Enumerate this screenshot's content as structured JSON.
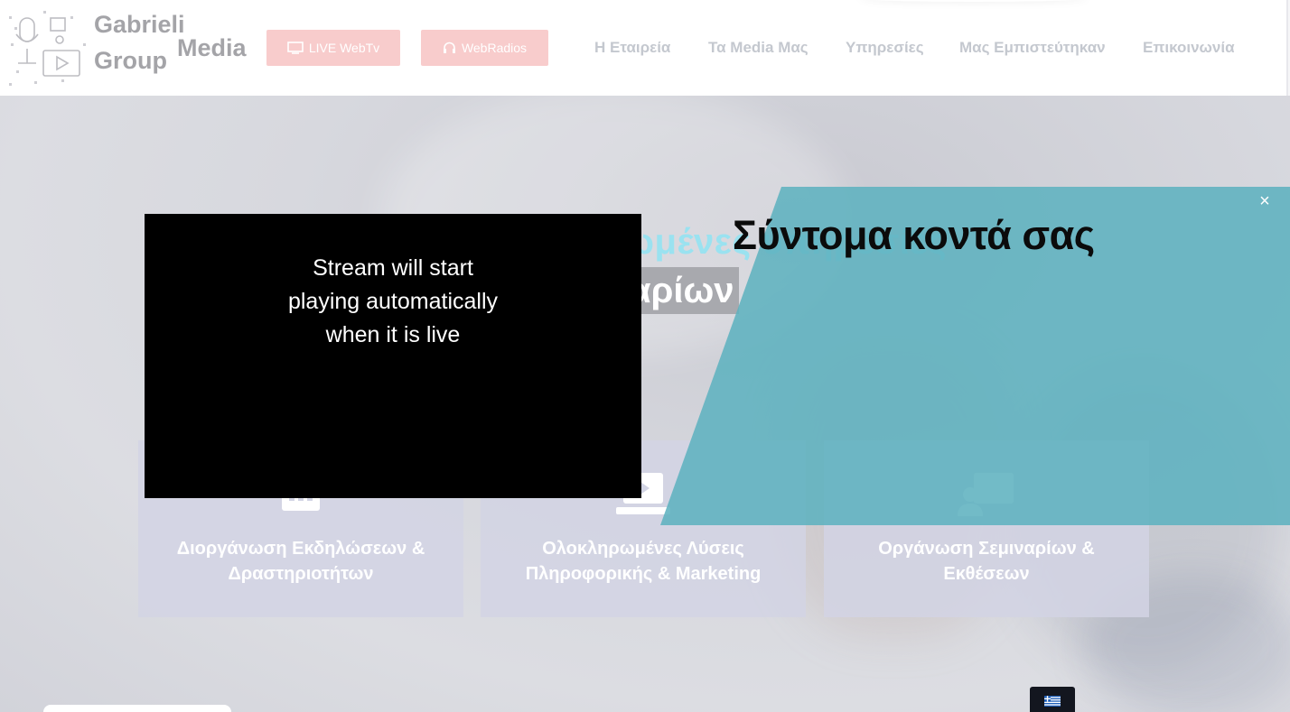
{
  "header": {
    "logo_text_line1": "Gabrieli",
    "logo_text_line2": "Group",
    "logo_text_media": "Media",
    "buttons": {
      "webtv": "LIVE WebTv",
      "radios": "WebRadios"
    },
    "nav": [
      "Η Εταιρεία",
      "Τα Media Μας",
      "Υπηρεσίες",
      "Μας Εμπιστεύτηκαν",
      "Επικοινωνία"
    ]
  },
  "hero": {
    "title_partial": "ηρωμένες υπηρεσίες",
    "subtitle_partial": "αρίων",
    "cards": [
      {
        "title": "Διοργάνωση Εκδηλώσεων & Δραστηριοτήτων",
        "icon": "calendar-icon"
      },
      {
        "title": "Ολοκληρωμένες Λύσεις Πληροφορικής & Marketing",
        "icon": "laptop-icon"
      },
      {
        "title": "Οργάνωση Σεμιναρίων & Εκθέσεων",
        "icon": "presenter-icon"
      }
    ]
  },
  "promo": {
    "title": "Σύντομα κοντά σας",
    "close_label": "×"
  },
  "player": {
    "message_lines": [
      "Stream will start",
      "playing automatically",
      "when it is live"
    ]
  },
  "colors": {
    "teal": "#5fb2bf",
    "button_pink": "#f8cccc",
    "nav_text": "#c4c8cf",
    "hero_title": "#9ae2f0"
  }
}
